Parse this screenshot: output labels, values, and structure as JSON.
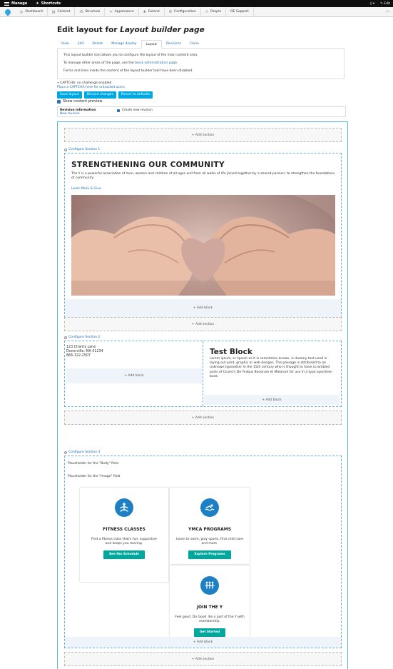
{
  "toolbar": {
    "manage": "Manage",
    "shortcuts": "Shortcuts",
    "edit": "Edit"
  },
  "admin_menu": [
    "Dashboard",
    "Content",
    "Structure",
    "Appearance",
    "Extend",
    "Configuration",
    "People",
    "OE Support"
  ],
  "page": {
    "title_prefix": "Edit layout for ",
    "title_em": "Layout builder page"
  },
  "tabs": [
    "View",
    "Edit",
    "Delete",
    "Manage display",
    "Layout",
    "Revisions",
    "Clone"
  ],
  "messages": {
    "line1": "This layout builder tool allows you to configure the layout of the main content area.",
    "line2_pre": "To manage other areas of the page, use the ",
    "line2_link": "block administration page",
    "line2_post": ".",
    "line3": "Forms and links inside the content of the layout builder tool have been disabled."
  },
  "captcha": {
    "status": "• CAPTCHA: no challenge enabled",
    "link": "Place a CAPTCHA here for untrusted users."
  },
  "buttons": {
    "save": "Save layout",
    "discard": "Discard changes",
    "revert": "Revert to defaults"
  },
  "preview_label": "Show content preview",
  "revision": {
    "label": "Revision information",
    "sub": "New revision",
    "checkbox": "Create new revision"
  },
  "builder": {
    "add_section": "+ Add section",
    "add_block": "+ Add block",
    "configure_1": "Configure Section 1",
    "configure_2": "Configure Section 2",
    "configure_3": "Configure Section 3"
  },
  "section1": {
    "heading": "STRENGTHENING OUR COMMUNITY",
    "body": "The Y is a powerful association of men, women and children of all ages and from all walks of life joined together by a shared passion: to strengthen the foundations of community.",
    "link": "Learn More & Give"
  },
  "section2": {
    "address1": "123 Charity Lane",
    "address2": "Donorville, MA 01234",
    "phone": "866-322-2507",
    "block_title": "Test Block",
    "block_text": "Lorem ipsum, or lipsum as it is sometimes known, is dummy text used in laying out print, graphic or web designs. The passage is attributed to an unknown typesetter in the 15th century who is thought to have scrambled parts of Cicero's De Finibus Bonorum et Malorum for use in a type specimen book."
  },
  "section3": {
    "body_placeholder": "Placeholder for the \"Body\" field",
    "image_placeholder": "Placeholder for the \"Image\" field",
    "cards": [
      {
        "icon": "meditation-icon",
        "title": "FITNESS CLASSES",
        "text": "Find a fitness class that's fun, supportive and keeps you moving.",
        "button": "See the Schedule"
      },
      {
        "icon": "swimmer-icon",
        "title": "YMCA PROGRAMS",
        "text": "Learn to swim, play sports, find child care and more.",
        "button": "Explore Programs"
      },
      {
        "icon": "group-icon",
        "title": "JOIN THE Y",
        "text": "Feel good. Do Good. Be a part of the Y with membership.",
        "button": "Get Started"
      }
    ]
  },
  "colors": {
    "accent_blue": "#00a8e1",
    "link_blue": "#1a6bb0",
    "card_icon": "#1d7fc4",
    "card_button": "#00a79d"
  }
}
